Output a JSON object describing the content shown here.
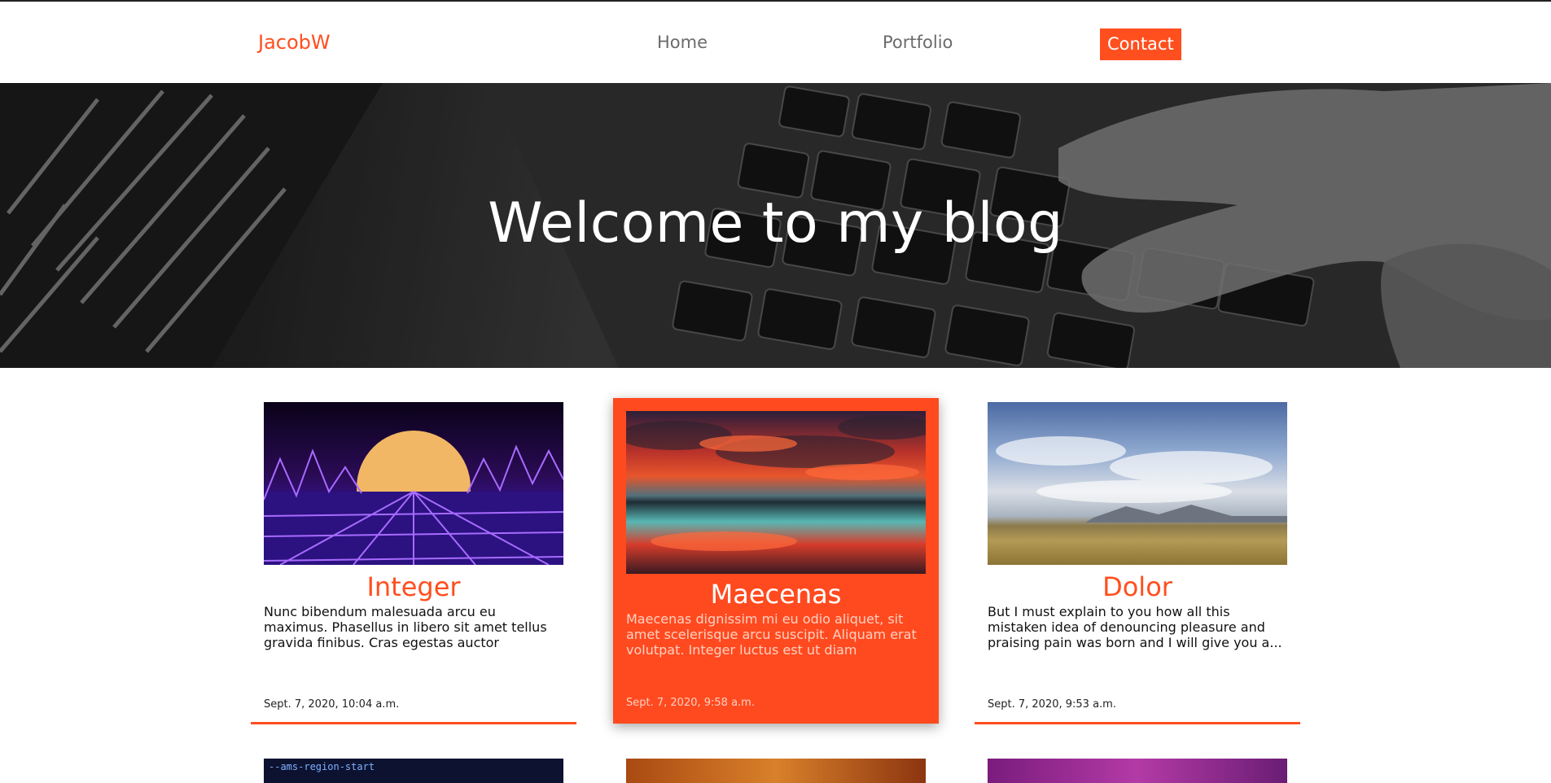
{
  "nav": {
    "brand": "JacobW",
    "links": [
      "Home",
      "Portfolio"
    ],
    "contact": "Contact"
  },
  "hero": {
    "title": "Welcome to my blog"
  },
  "posts": [
    {
      "title": "Integer",
      "excerpt": "Nunc bibendum malesuada arcu eu maximus. Phasellus in libero sit amet tellus gravida finibus. Cras egestas auctor efficitur....",
      "date": "Sept. 7, 2020, 10:04 a.m."
    },
    {
      "title": "Maecenas",
      "excerpt": "Maecenas dignissim mi eu odio aliquet, sit amet scelerisque arcu suscipit. Aliquam erat volutpat. Integer luctus est ut diam tristique...",
      "date": "Sept. 7, 2020, 9:58 a.m."
    },
    {
      "title": "Dolor",
      "excerpt": "But I must explain to you how all this mistaken idea of denouncing pleasure and praising pain was born and I will give you a...",
      "date": "Sept. 7, 2020, 9:53 a.m."
    }
  ],
  "colors": {
    "accent": "#ff4f1f",
    "nav_text": "#6b6b6b"
  }
}
